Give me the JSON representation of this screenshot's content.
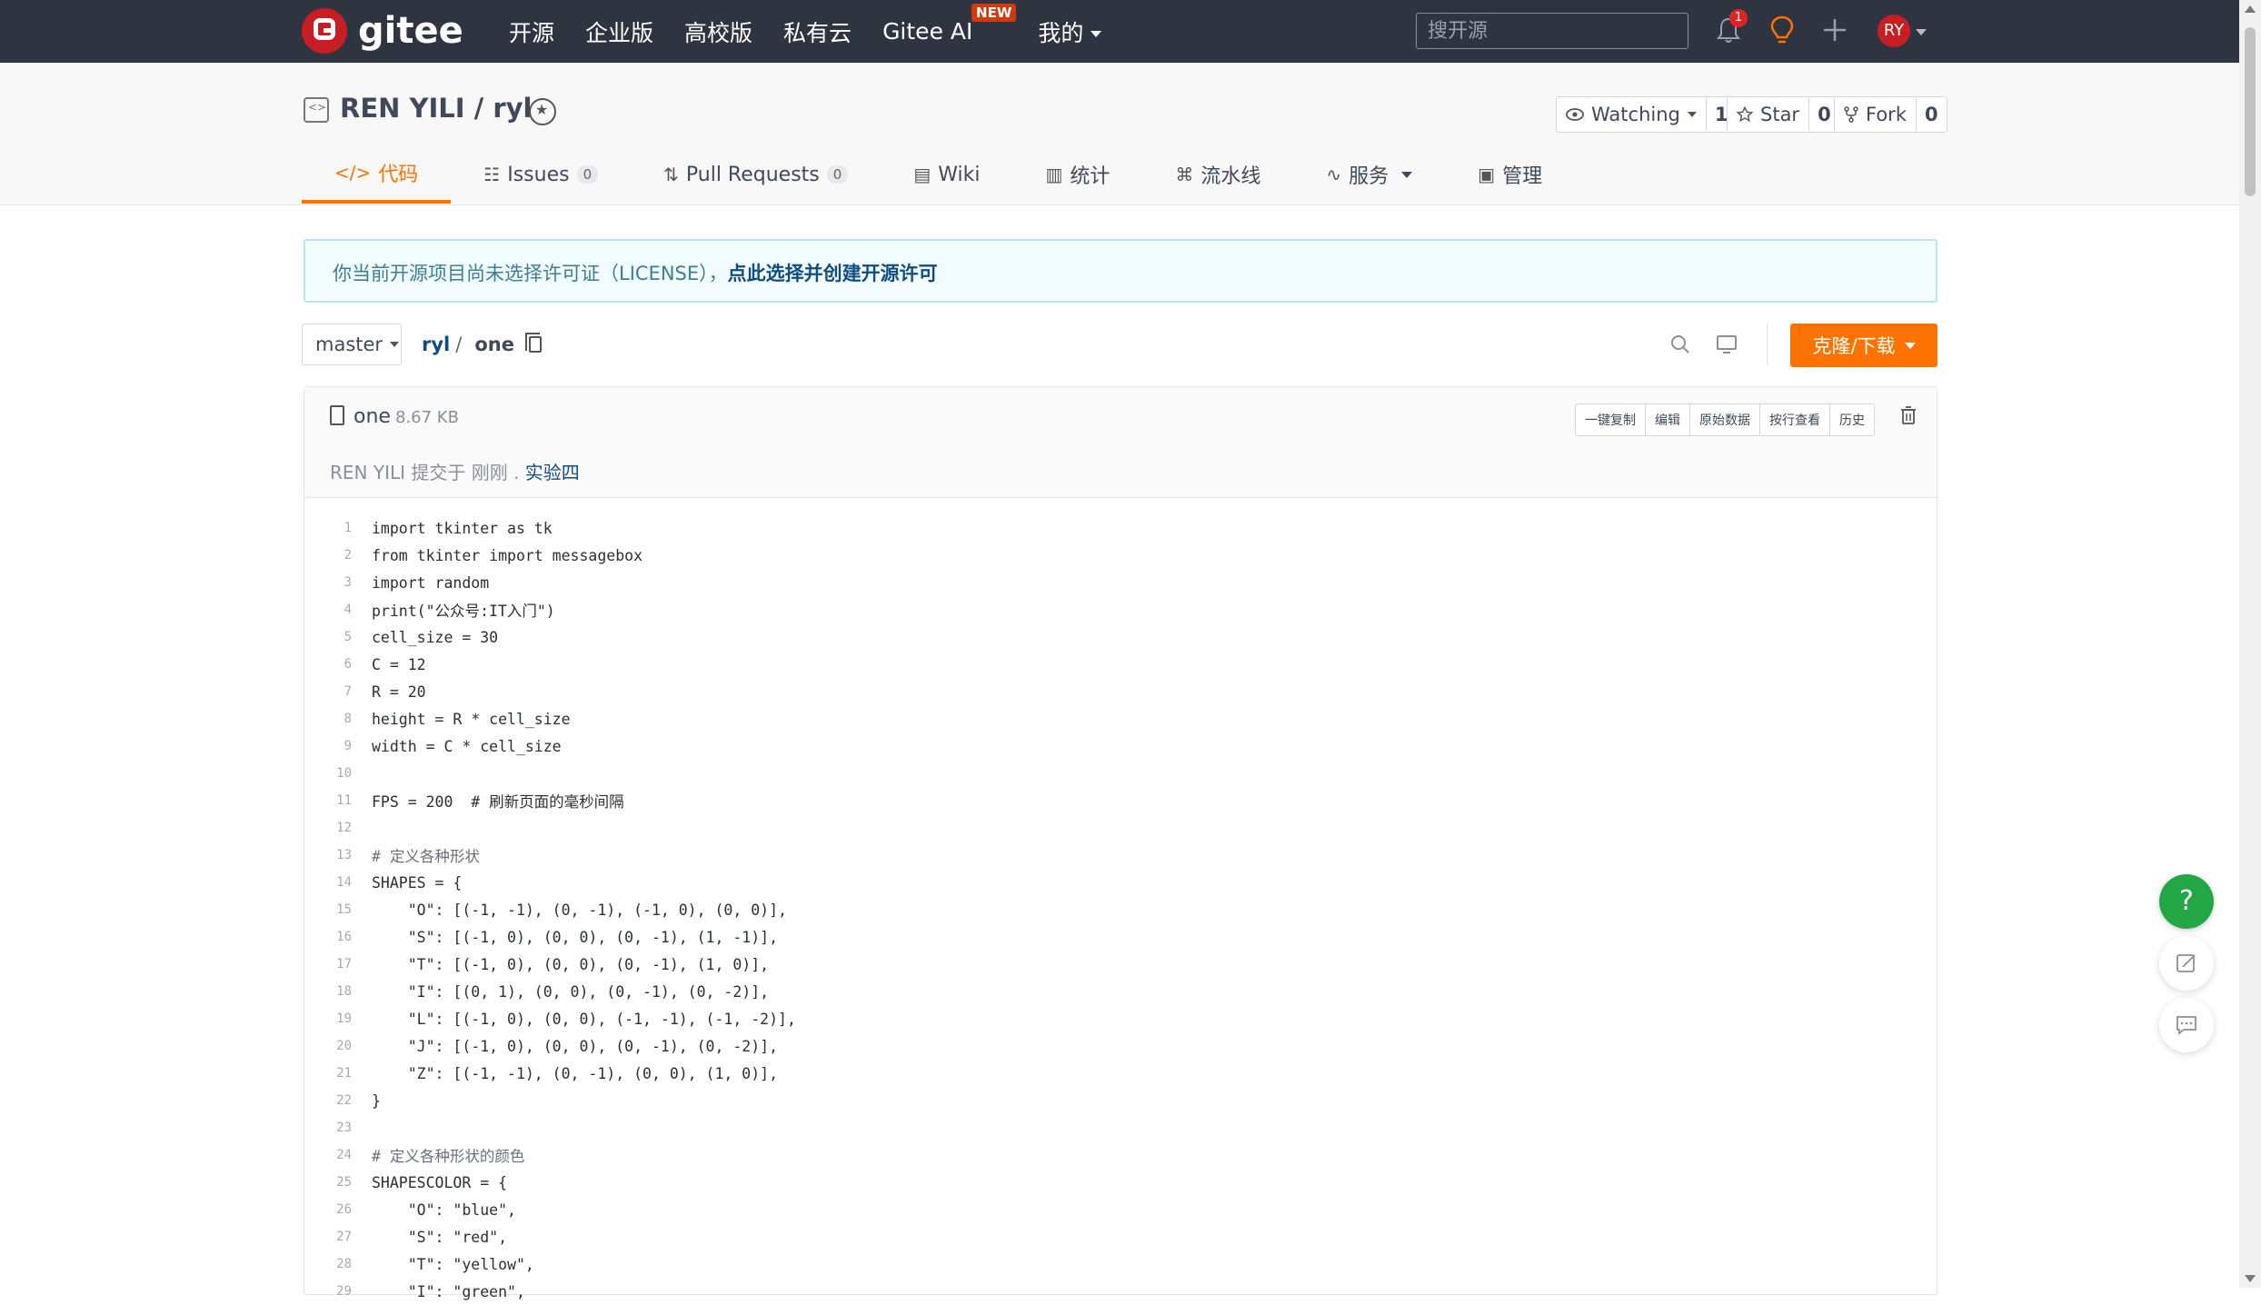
{
  "nav": {
    "logo_text": "gitee",
    "items": [
      "开源",
      "企业版",
      "高校版",
      "私有云",
      "Gitee AI"
    ],
    "new_badge": "NEW",
    "mine": "我的",
    "search_placeholder": "搜开源",
    "notification_count": "1",
    "avatar_initials": "RY"
  },
  "repo": {
    "title": "REN YILI / ryl",
    "watching_label": "Watching",
    "watching_count": "1",
    "star_label": "Star",
    "star_count": "0",
    "fork_label": "Fork",
    "fork_count": "0"
  },
  "tabs": [
    {
      "label": "代码",
      "icon": "code-icon"
    },
    {
      "label": "Issues",
      "count": "0",
      "icon": "issue-icon"
    },
    {
      "label": "Pull Requests",
      "count": "0",
      "icon": "pull-request-icon"
    },
    {
      "label": "Wiki",
      "icon": "book-icon"
    },
    {
      "label": "统计",
      "icon": "bar-chart-icon"
    },
    {
      "label": "流水线",
      "icon": "pipeline-icon"
    },
    {
      "label": "服务",
      "icon": "pulse-icon"
    },
    {
      "label": "管理",
      "icon": "settings-doc-icon"
    }
  ],
  "notice": {
    "text": "你当前开源项目尚未选择许可证（LICENSE），",
    "link": "点此选择并创建开源许可"
  },
  "path": {
    "branch": "master",
    "repo": "ryl",
    "sep": "/",
    "file": "one",
    "clone_label": "克隆/下载"
  },
  "file": {
    "name": "one",
    "size": "8.67 KB",
    "buttons": [
      "一键复制",
      "编辑",
      "原始数据",
      "按行查看",
      "历史"
    ],
    "commit_text": "REN YILI 提交于 刚刚 . ",
    "commit_link": "实验四"
  },
  "code_lines": [
    "import tkinter as tk",
    "from tkinter import messagebox",
    "import random",
    "print(\"公众号:IT入门\")",
    "cell_size = 30",
    "C = 12",
    "R = 20",
    "height = R * cell_size",
    "width = C * cell_size",
    "",
    "FPS = 200  # 刷新页面的毫秒间隔",
    "",
    "# 定义各种形状",
    "SHAPES = {",
    "    \"O\": [(-1, -1), (0, -1), (-1, 0), (0, 0)],",
    "    \"S\": [(-1, 0), (0, 0), (0, -1), (1, -1)],",
    "    \"T\": [(-1, 0), (0, 0), (0, -1), (1, 0)],",
    "    \"I\": [(0, 1), (0, 0), (0, -1), (0, -2)],",
    "    \"L\": [(-1, 0), (0, 0), (-1, -1), (-1, -2)],",
    "    \"J\": [(-1, 0), (0, 0), (0, -1), (0, -2)],",
    "    \"Z\": [(-1, -1), (0, -1), (0, 0), (1, 0)],",
    "}",
    "",
    "# 定义各种形状的颜色",
    "SHAPESCOLOR = {",
    "    \"O\": \"blue\",",
    "    \"S\": \"red\",",
    "    \"T\": \"yellow\",",
    "    \"I\": \"green\","
  ],
  "help_label": "?",
  "colors": {
    "brand": "#c71d23",
    "accent": "#fe7300",
    "nav_bg": "#2e3440",
    "help_green": "#23a745"
  }
}
